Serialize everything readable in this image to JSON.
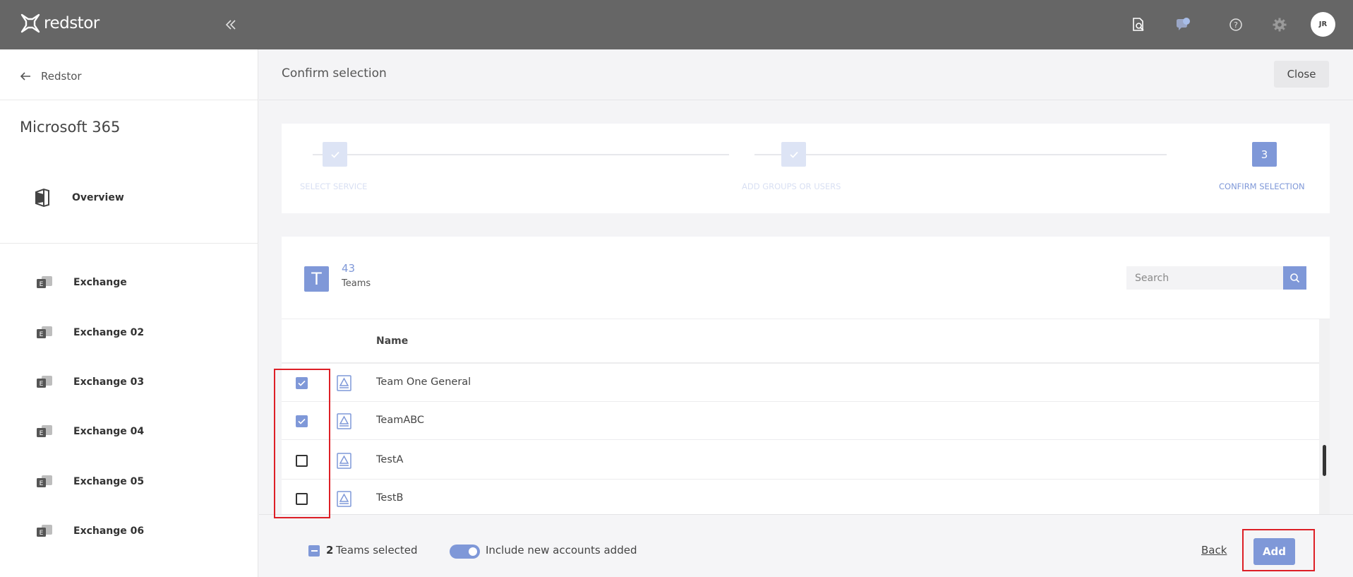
{
  "topbar": {
    "brand": "redstor",
    "avatar_initials": "JR",
    "icons": [
      "search-document-icon",
      "notification-bubble-icon",
      "help-icon",
      "gear-icon"
    ]
  },
  "sidebar": {
    "back_label": "Redstor",
    "product_title": "Microsoft 365",
    "overview_label": "Overview",
    "items": [
      {
        "label": "Exchange"
      },
      {
        "label": "Exchange 02"
      },
      {
        "label": "Exchange 03"
      },
      {
        "label": "Exchange 04"
      },
      {
        "label": "Exchange 05"
      },
      {
        "label": "Exchange 06"
      }
    ]
  },
  "header": {
    "title": "Confirm selection",
    "close_label": "Close"
  },
  "stepper": {
    "steps": [
      {
        "label": "SELECT SERVICE",
        "state": "done"
      },
      {
        "label": "ADD GROUPS OR USERS",
        "state": "done"
      },
      {
        "label": "CONFIRM SELECTION",
        "state": "active",
        "number": "3"
      }
    ]
  },
  "teams": {
    "badge": "T",
    "count": "43",
    "label": "Teams",
    "search_placeholder": "Search",
    "column_name": "Name",
    "rows": [
      {
        "name": "Team One General",
        "checked": true
      },
      {
        "name": "TeamABC",
        "checked": true
      },
      {
        "name": "TestA",
        "checked": false
      },
      {
        "name": "TestB",
        "checked": false
      }
    ]
  },
  "footer": {
    "selected_count": "2",
    "selected_text": "Teams selected",
    "include_new_label": "Include new accounts added",
    "include_new_enabled": true,
    "back_label": "Back",
    "add_label": "Add"
  },
  "colors": {
    "accent": "#7f98d8",
    "topbar": "#666666",
    "highlight": "#dd1f26"
  }
}
